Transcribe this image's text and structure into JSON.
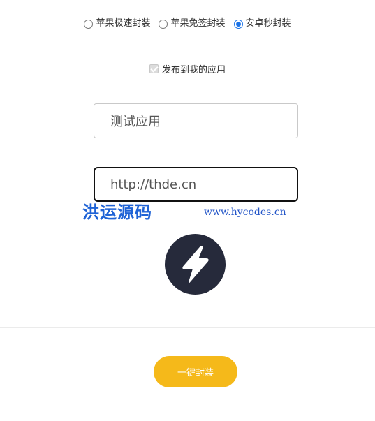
{
  "package_options": [
    {
      "label": "苹果极速封装",
      "checked": false
    },
    {
      "label": "苹果免签封装",
      "checked": false
    },
    {
      "label": "安卓秒封装",
      "checked": true
    }
  ],
  "publish": {
    "label": "发布到我的应用",
    "checked": true,
    "disabled": true
  },
  "app_name_field": {
    "value": "测试应用"
  },
  "app_url_field": {
    "value": "http://thde.cn"
  },
  "watermark": {
    "text_cn": "洪运源码",
    "url": "www.hycodes.cn"
  },
  "app_icon": {
    "icon": "lightning-bolt-icon",
    "background": "#262a3b"
  },
  "submit_button": {
    "label": "一键封装",
    "color": "#f5b91a"
  },
  "colors": {
    "radio_accent": "#1a73e8"
  }
}
